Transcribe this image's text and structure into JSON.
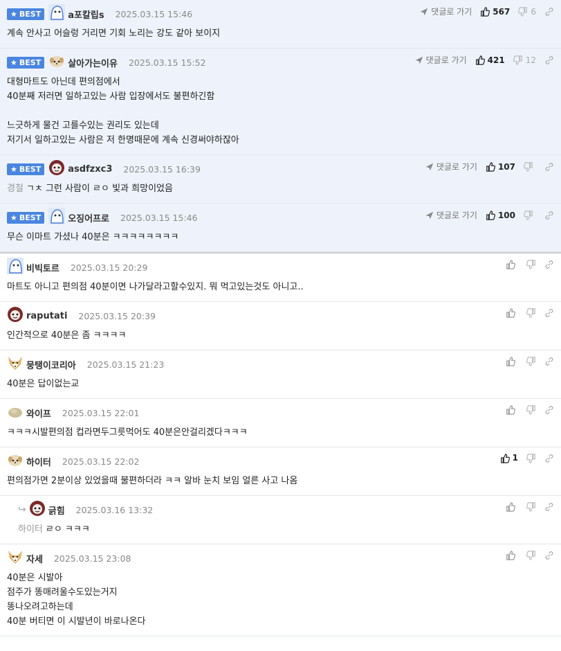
{
  "labels": {
    "best": "BEST",
    "goto": "댓글로 가기"
  },
  "best_comments": [
    {
      "nick": "a포칼립s",
      "time": "2025.03.15 15:46",
      "likes": "567",
      "dislikes": "6",
      "text": "계속 안사고 어슬렁 거리면 기회 노리는 강도 같아 보이지",
      "avatar": "blue-ghost"
    },
    {
      "nick": "살아가는이유",
      "time": "2025.03.15 15:52",
      "likes": "421",
      "dislikes": "12",
      "text": "대형마트도 아닌데 편의점에서\n40분째 저러면 일하고있는 사람 입장에서도 불편하긴함\n\n느긋하게 물건 고를수있는 권리도 있는데\n저기서 일하고있는 사람은 저 한명때문에 계속 신경써야하잖아",
      "avatar": "puppy"
    },
    {
      "nick": "asdfzxc3",
      "time": "2025.03.15 16:39",
      "likes": "107",
      "dislikes": "",
      "ref": "경철",
      "text": "ㄱㅊ 그런 사람이 ㄹㅇ 빛과 희망이었음",
      "avatar": "creature"
    },
    {
      "nick": "오징어프로",
      "time": "2025.03.15 15:46",
      "likes": "100",
      "dislikes": "",
      "text": "무슨 이마트 가셨나 40분은 ㅋㅋㅋㅋㅋㅋㅋㅋ",
      "avatar": "blue-ghost"
    }
  ],
  "comments": [
    {
      "nick": "비빅토르",
      "time": "2025.03.15 20:29",
      "likes": "",
      "text": "마트도 아니고 편의점 40분이면 나가달라고할수있지. 뭐 먹고있는것도 아니고..",
      "avatar": "blue-ghost"
    },
    {
      "nick": "raputati",
      "time": "2025.03.15 20:39",
      "likes": "",
      "text": "인간적으로 40분은 좀 ㅋㅋㅋㅋ",
      "avatar": "creature"
    },
    {
      "nick": "뭉탱이코리아",
      "time": "2025.03.15 21:23",
      "likes": "",
      "text": "40분은 답이없는교",
      "avatar": "fox"
    },
    {
      "nick": "와이프",
      "time": "2025.03.15 22:01",
      "likes": "",
      "text": "ㅋㅋㅋ시발편의점 컵라면두그릇먹어도 40분은안걸리겠다ㅋㅋㅋ",
      "avatar": "rock"
    },
    {
      "nick": "하이터",
      "time": "2025.03.15 22:02",
      "likes": "1",
      "text": "편의점가면 2분이상 있었을때 불편하더라 ㅋㅋ 알바 눈치 보임 얼른 사고 나옴",
      "avatar": "puppy"
    },
    {
      "nick": "긁힘",
      "time": "2025.03.16 13:32",
      "likes": "",
      "reply": true,
      "ref": "하이터",
      "text": "ㄹㅇ ㅋㅋㅋ",
      "avatar": "creature"
    },
    {
      "nick": "자세",
      "time": "2025.03.15 23:08",
      "likes": "",
      "text": "40분은 시발아\n점주가 똥매려울수도있는거지\n똥나오려고하는데\n40분 버티면 이 시발년이 바로나온다",
      "avatar": "fox"
    }
  ],
  "colors": {
    "best_bg": "#eef3fb",
    "badge": "#4a86e0"
  }
}
